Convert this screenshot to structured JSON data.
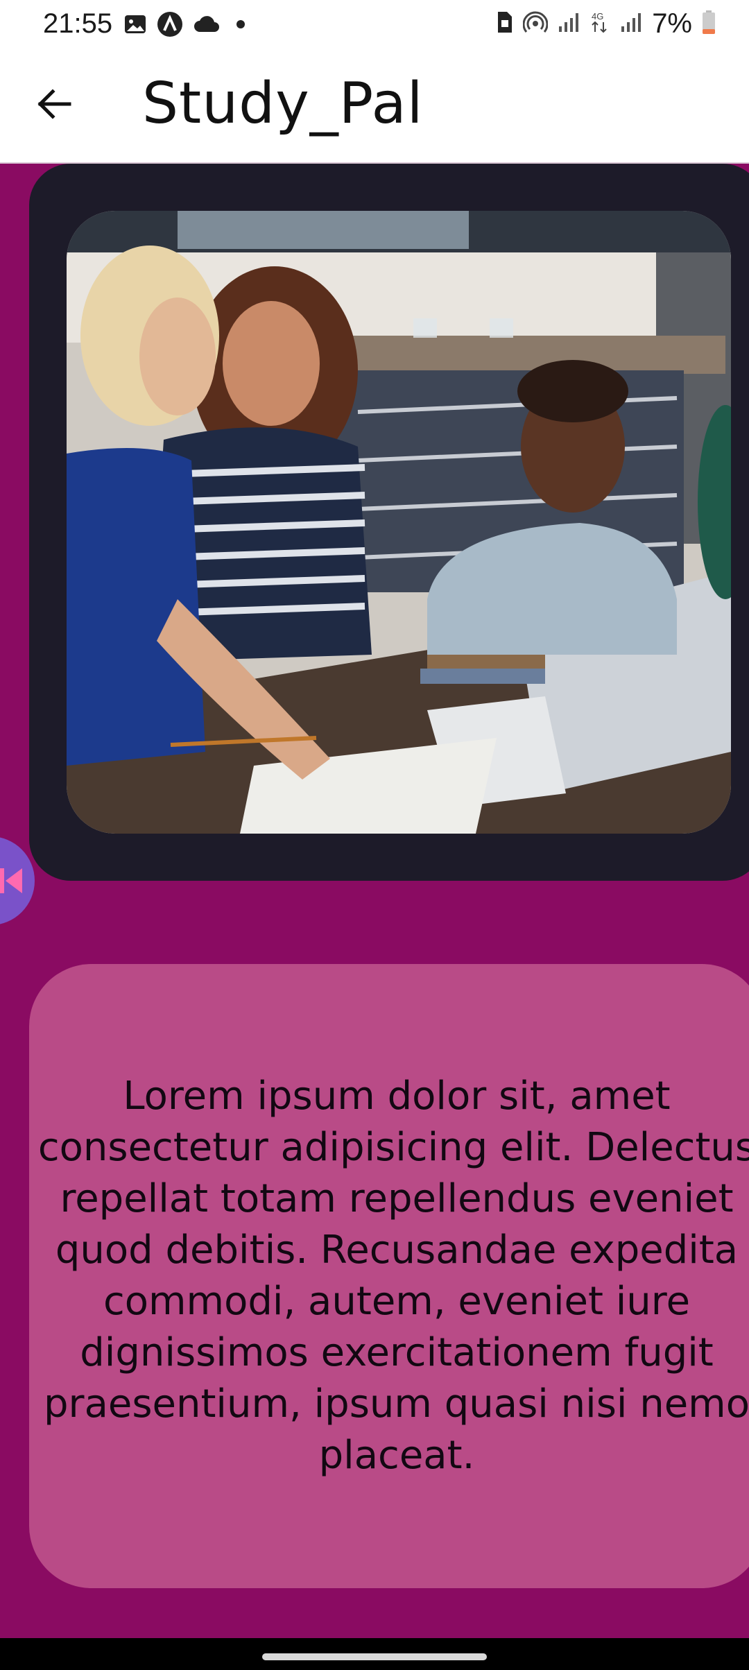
{
  "status_bar": {
    "time": "21:55",
    "battery_percent": "7%",
    "icons_left": [
      "image-icon",
      "a-circle-icon",
      "cloud-icon",
      "dot-icon"
    ],
    "icons_right": [
      "sim-icon",
      "hotspot-icon",
      "signal-icon",
      "network-4g-icon",
      "signal-icon",
      "battery-low-icon"
    ]
  },
  "app_bar": {
    "title": "Study_Pal",
    "back_icon": "arrow-left-icon"
  },
  "image_card": {
    "alt": "Group of students smiling at a table with a laptop"
  },
  "side_button": {
    "icon": "skip-previous-icon",
    "color": "#7a52c9"
  },
  "text_card": {
    "body": "Lorem ipsum dolor sit, amet consectetur adipisicing elit. Delectus repellat totam repellendus eveniet quod debitis. Recusandae expedita commodi, autem, eveniet iure dignissimos exercitationem fugit praesentium, ipsum quasi nisi nemo placeat."
  },
  "colors": {
    "background": "#8a0b62",
    "image_card": "#1d1b29",
    "text_card": "#b94b87"
  }
}
